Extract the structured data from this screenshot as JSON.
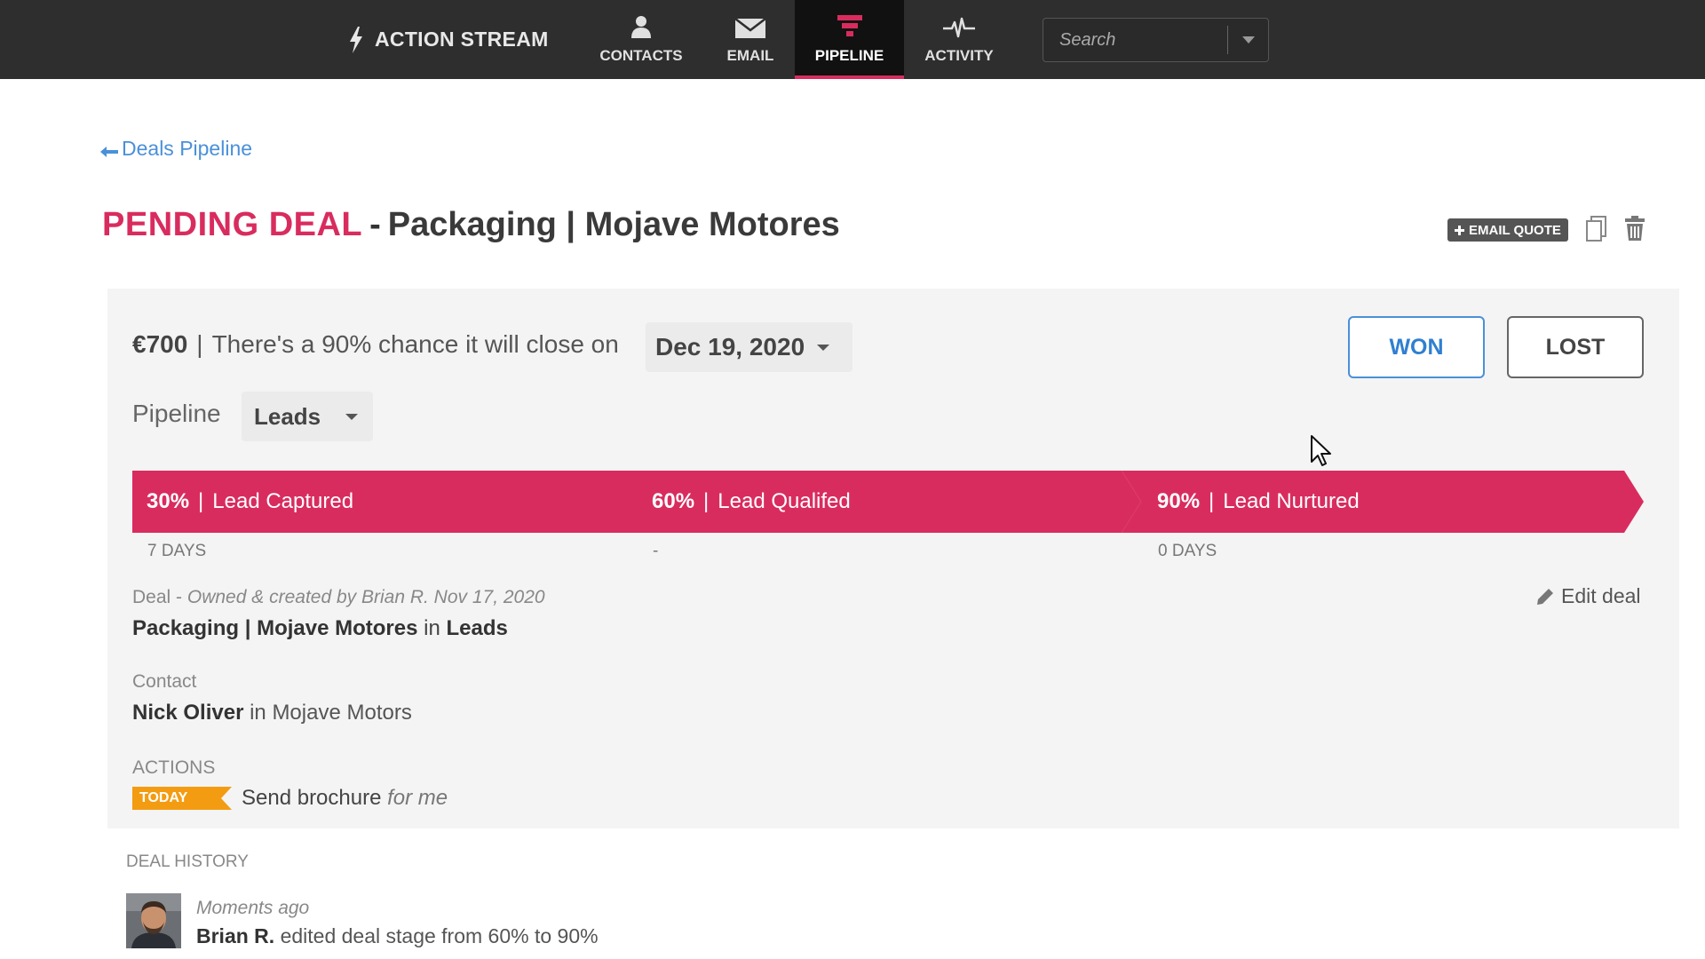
{
  "nav": {
    "action_stream": "ACTION STREAM",
    "items": [
      {
        "label": "CONTACTS",
        "icon": "person-icon"
      },
      {
        "label": "EMAIL",
        "icon": "envelope-icon"
      },
      {
        "label": "PIPELINE",
        "icon": "funnel-icon",
        "active": true
      },
      {
        "label": "ACTIVITY",
        "icon": "pulse-icon"
      }
    ],
    "search_placeholder": "Search"
  },
  "back_link": "Deals Pipeline",
  "title": {
    "status": "PENDING DEAL",
    "separator": "-",
    "deal_name": "Packaging | Mojave Motores"
  },
  "toolbar": {
    "email_quote": "EMAIL QUOTE"
  },
  "summary": {
    "amount": "€700",
    "separator": "|",
    "chance_text": "There's a 90% chance it will close on",
    "close_date": "Dec 19, 2020",
    "won_label": "WON",
    "lost_label": "LOST",
    "pipeline_label": "Pipeline",
    "pipeline_value": "Leads"
  },
  "stages": [
    {
      "percent": "30%",
      "name": "Lead Captured",
      "days": "7 DAYS"
    },
    {
      "percent": "60%",
      "name": "Lead Qualifed",
      "days": "-"
    },
    {
      "percent": "90%",
      "name": "Lead Nurtured",
      "days": "0 DAYS"
    }
  ],
  "deal": {
    "label": "Deal",
    "meta": "Owned & created by Brian R. Nov 17, 2020",
    "name": "Packaging | Mojave Motores",
    "in_word": "in",
    "pipeline": "Leads",
    "edit_label": "Edit deal"
  },
  "contact": {
    "label": "Contact",
    "name": "Nick Oliver",
    "in_word": "in",
    "company": "Mojave Motors"
  },
  "actions": {
    "label": "ACTIONS",
    "badge": "TODAY",
    "task": "Send brochure",
    "assignee": "for me"
  },
  "history": {
    "label": "DEAL HISTORY",
    "time": "Moments ago",
    "user": "Brian R.",
    "text": "edited deal stage from 60% to 90%"
  },
  "colors": {
    "accent": "#d92c5e",
    "link": "#4a90d9",
    "topbar": "#2e2e2e",
    "badge": "#f39c12"
  }
}
